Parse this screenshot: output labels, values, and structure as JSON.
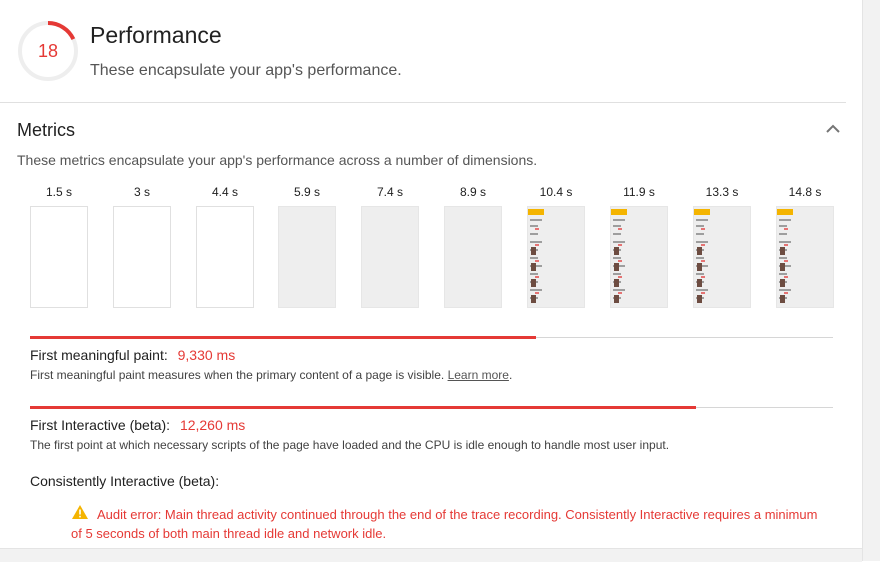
{
  "performance": {
    "score": "18",
    "score_fraction": 0.18,
    "title": "Performance",
    "description": "These encapsulate your app's performance."
  },
  "metrics": {
    "title": "Metrics",
    "description": "These metrics encapsulate your app's performance across a number of dimensions.",
    "filmstrip": [
      {
        "time": "1.5 s",
        "state": "blank"
      },
      {
        "time": "3 s",
        "state": "blank"
      },
      {
        "time": "4.4 s",
        "state": "blank"
      },
      {
        "time": "5.9 s",
        "state": "gray"
      },
      {
        "time": "7.4 s",
        "state": "gray"
      },
      {
        "time": "8.9 s",
        "state": "gray"
      },
      {
        "time": "10.4 s",
        "state": "content"
      },
      {
        "time": "11.9 s",
        "state": "content"
      },
      {
        "time": "13.3 s",
        "state": "content"
      },
      {
        "time": "14.8 s",
        "state": "content"
      }
    ],
    "first_meaningful_paint": {
      "label": "First meaningful paint:",
      "value": "9,330 ms",
      "progress": 0.63,
      "description": "First meaningful paint measures when the primary content of a page is visible.",
      "link": "Learn more"
    },
    "first_interactive": {
      "label": "First Interactive (beta):",
      "value": "12,260 ms",
      "progress": 0.83,
      "description": "The first point at which necessary scripts of the page have loaded and the CPU is idle enough to handle most user input."
    },
    "consistently_interactive": {
      "label": "Consistently Interactive (beta):",
      "error": "Audit error: Main thread activity continued through the end of the trace recording. Consistently Interactive requires a minimum of 5 seconds of both main thread idle and network idle."
    }
  },
  "colors": {
    "fail": "#e53935",
    "accent_badge": "#f4b400",
    "warning": "#f4b400"
  }
}
